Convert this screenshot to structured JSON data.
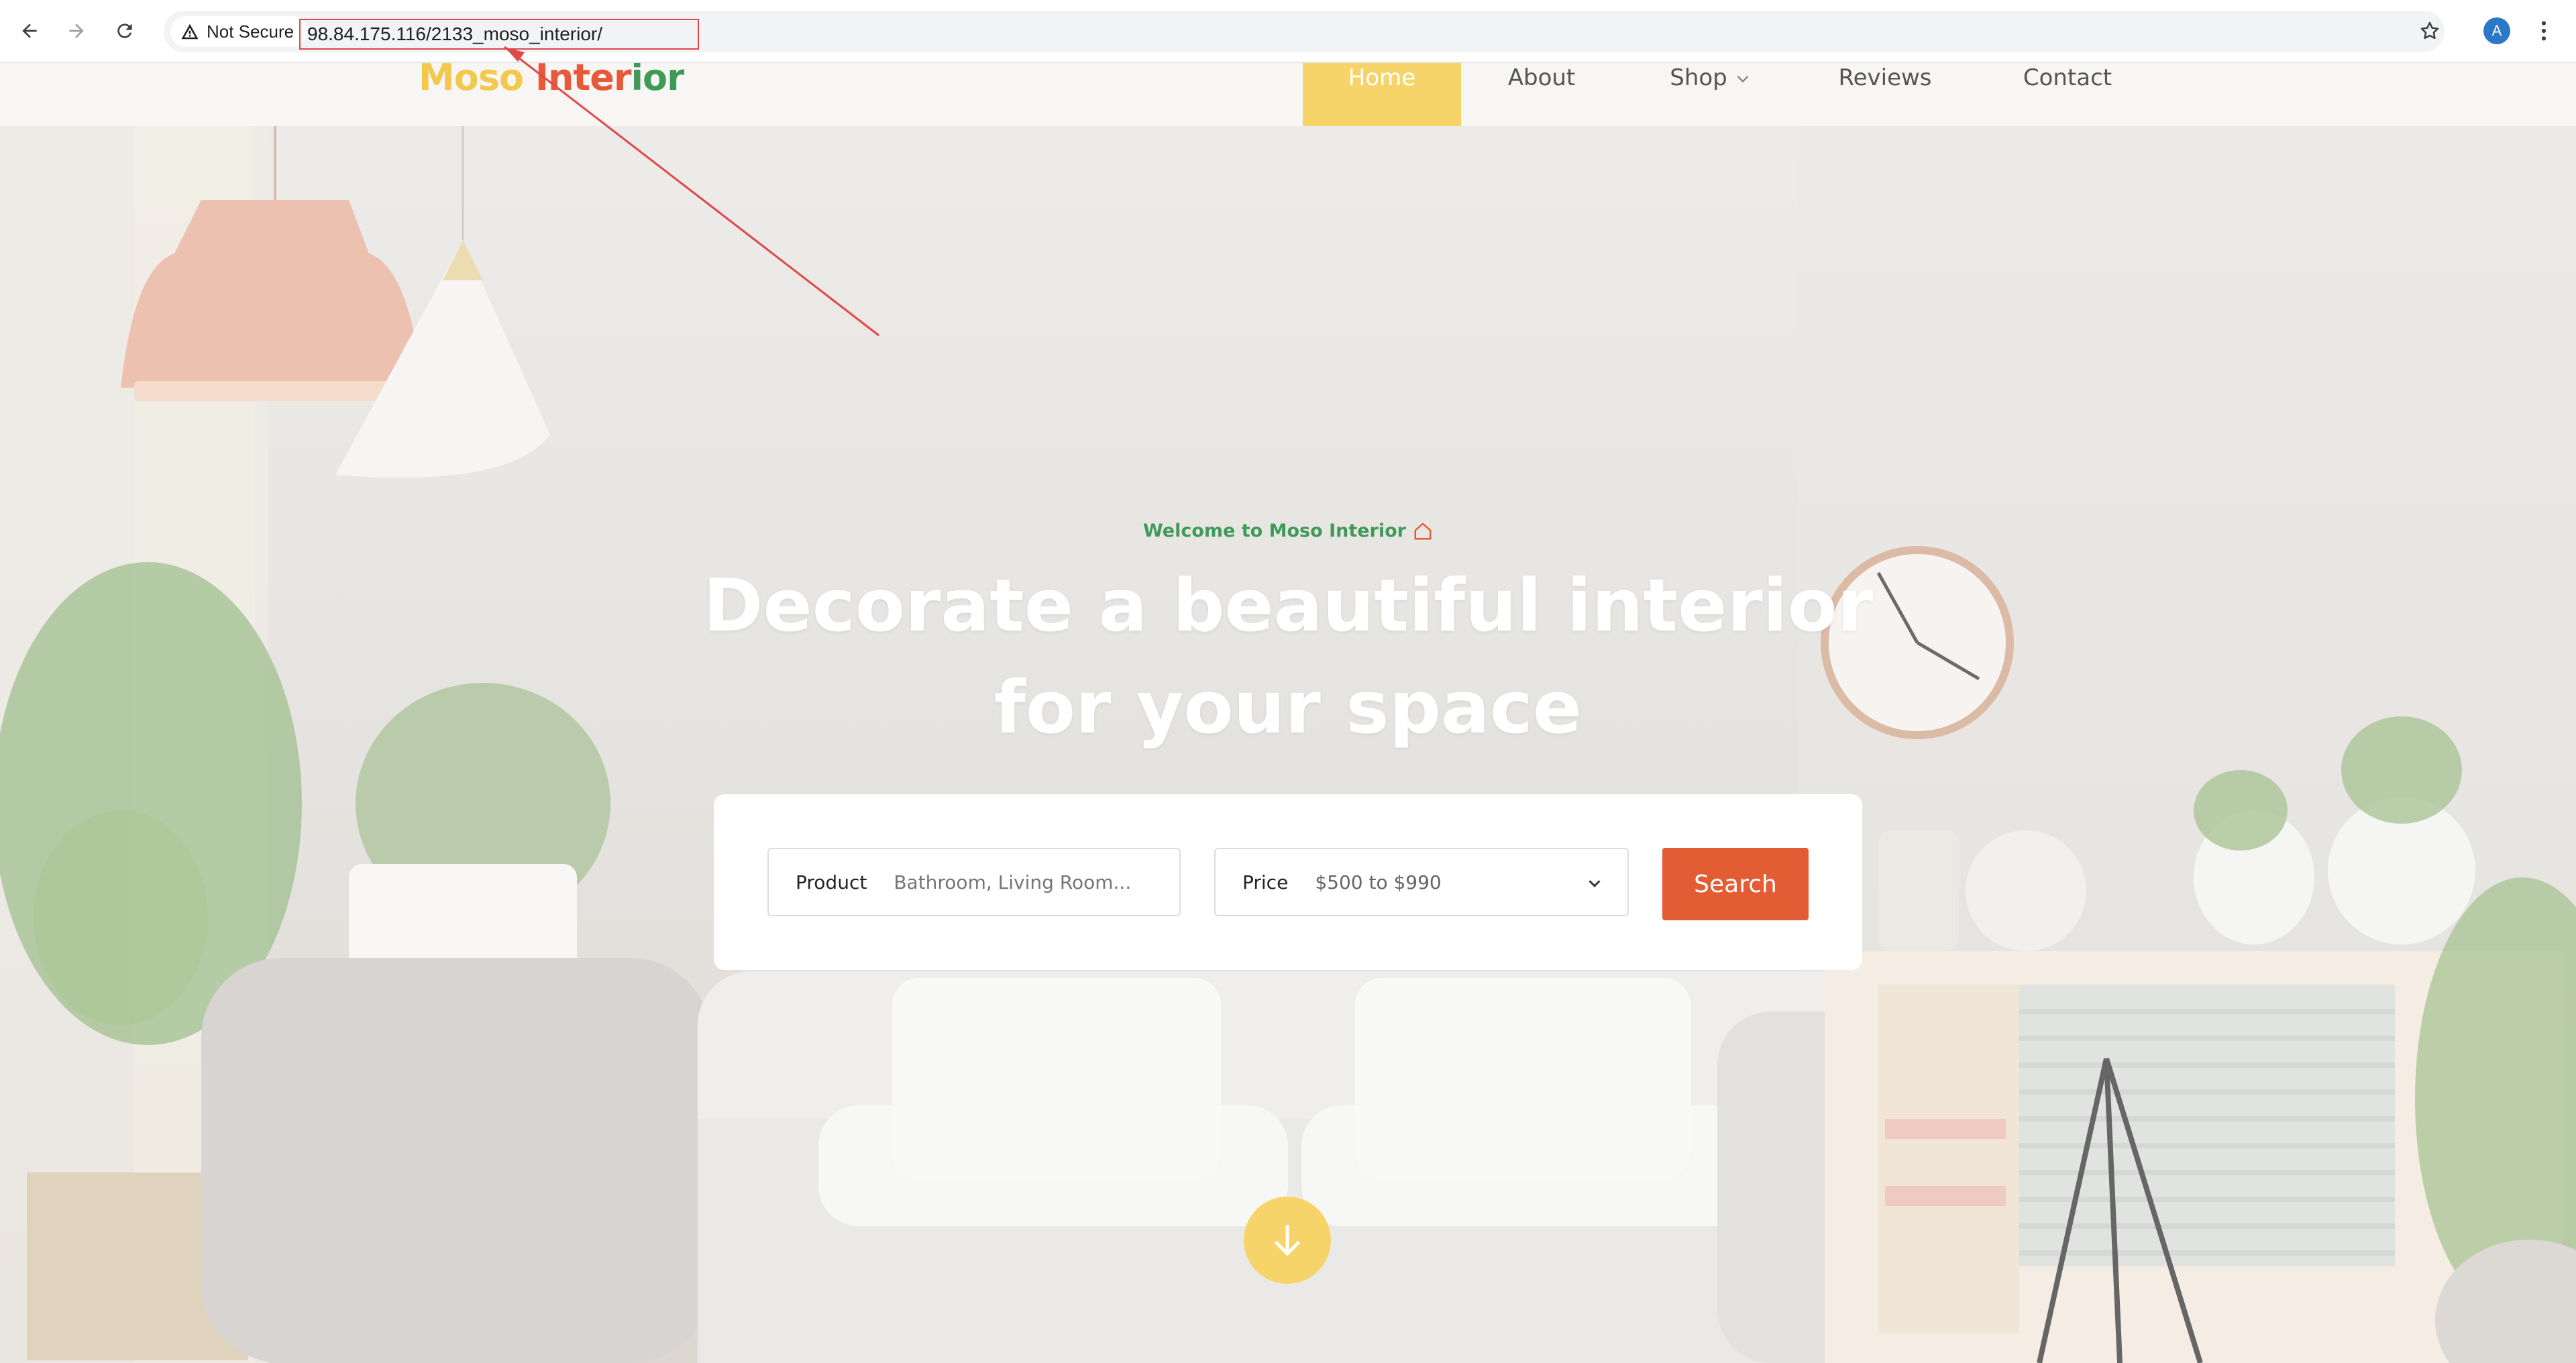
{
  "browser": {
    "security_label": "Not Secure",
    "url": "98.84.175.116/2133_moso_interior/",
    "profile_initial": "A",
    "icons": [
      "back-arrow-icon",
      "forward-arrow-icon",
      "reload-icon",
      "warning-icon",
      "star-icon",
      "more-vert-icon"
    ]
  },
  "site": {
    "logo_word1": "Moso",
    "logo_word2a": "Inter",
    "logo_word2b": "ior",
    "nav": [
      {
        "label": "Home",
        "active": true
      },
      {
        "label": "About"
      },
      {
        "label": "Shop"
      },
      {
        "label": "Reviews"
      },
      {
        "label": "Contact"
      }
    ]
  },
  "hero": {
    "welcome": "Welcome to Moso Interior",
    "headline_line1": "Decorate a beautiful interior",
    "headline_line2": "for your space",
    "product_label": "Product",
    "product_placeholder": "Bathroom, Living Room...",
    "price_label": "Price",
    "price_value": "$500 to $990",
    "search_label": "Search"
  },
  "colors": {
    "accent_yellow": "#f6d46a",
    "accent_orange": "#e35d34",
    "accent_green": "#3f9a58",
    "annotation_red": "#e0484b"
  }
}
